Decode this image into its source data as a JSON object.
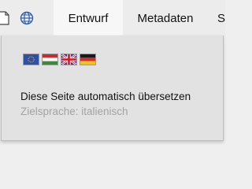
{
  "toolbar": {
    "icons": [
      "document-icon",
      "globe-icon"
    ],
    "tabs": [
      {
        "label": "Entwurf",
        "active": true
      },
      {
        "label": "Metadaten",
        "active": false
      },
      {
        "label": "S",
        "active": false
      }
    ]
  },
  "translate_popup": {
    "flags": [
      {
        "name": "eu-flag-icon"
      },
      {
        "name": "hungary-flag-icon"
      },
      {
        "name": "uk-flag-icon"
      },
      {
        "name": "germany-flag-icon"
      }
    ],
    "action_label": "Diese Seite automatisch übersetzen",
    "target_language_label": "Zielsprache: italienisch"
  },
  "colors": {
    "toolbar_bg": "#ececec",
    "active_tab_bg": "#f7f7f7",
    "popup_bg": "#e2e2e2",
    "muted_text": "#a3a3a3"
  }
}
